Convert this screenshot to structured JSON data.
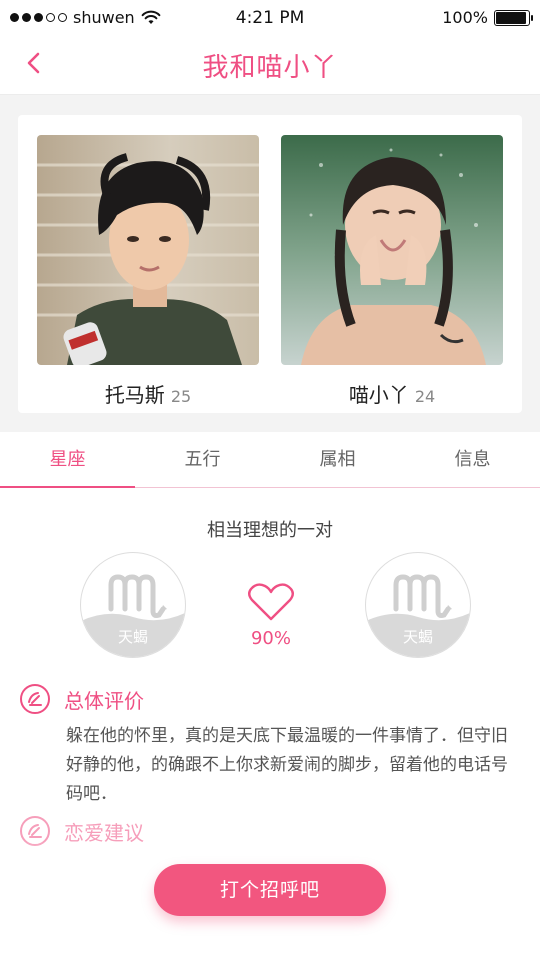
{
  "status_bar": {
    "carrier": "shuwen",
    "time": "4:21 PM",
    "battery": "100%",
    "signal_bars_filled": 3,
    "signal_bars_total": 5
  },
  "header": {
    "title": "我和喵小丫",
    "back_icon": "chevron-left-icon"
  },
  "persons": [
    {
      "name": "托马斯",
      "age": "25"
    },
    {
      "name": "喵小丫",
      "age": "24"
    }
  ],
  "tabs": [
    {
      "label": "星座",
      "active": true
    },
    {
      "label": "五行",
      "active": false
    },
    {
      "label": "属相",
      "active": false
    },
    {
      "label": "信息",
      "active": false
    }
  ],
  "match": {
    "title": "相当理想的一对",
    "left_sign": "天蝎",
    "right_sign": "天蝎",
    "percent": "90%",
    "heart_icon": "heart-icon"
  },
  "sections": [
    {
      "title": "总体评价",
      "body": "躲在他的怀里，真的是天底下最温暖的一件事情了．但守旧好静的他，的确跟不上你求新爱闹的脚步，留着他的电话号码吧．"
    },
    {
      "title": "恋爱建议"
    }
  ],
  "cta": {
    "label": "打个招呼吧"
  },
  "colors": {
    "accent": "#ef4f83",
    "button": "#f2567f"
  }
}
